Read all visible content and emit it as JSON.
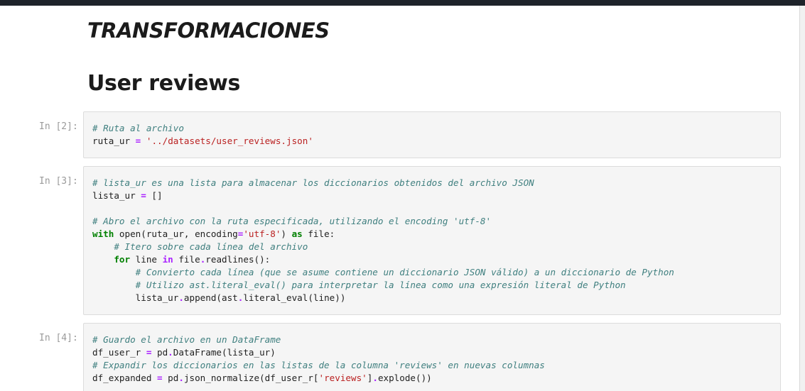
{
  "headings": {
    "section": "TRANSFORMACIONES",
    "subsection": "User reviews"
  },
  "cells": [
    {
      "prompt": "In [2]:",
      "lines": [
        [
          {
            "t": "# Ruta al archivo",
            "c": "c"
          }
        ],
        [
          {
            "t": "ruta_ur "
          },
          {
            "t": "=",
            "c": "o"
          },
          {
            "t": " "
          },
          {
            "t": "'../datasets/user_reviews.json'",
            "c": "s"
          }
        ]
      ]
    },
    {
      "prompt": "In [3]:",
      "lines": [
        [
          {
            "t": "# lista_ur es una lista para almacenar los diccionarios obtenidos del archivo JSON",
            "c": "c"
          }
        ],
        [
          {
            "t": "lista_ur "
          },
          {
            "t": "=",
            "c": "o"
          },
          {
            "t": " []"
          }
        ],
        [],
        [
          {
            "t": "# Abro el archivo con la ruta especificada, utilizando el encoding 'utf-8'",
            "c": "c"
          }
        ],
        [
          {
            "t": "with",
            "c": "k"
          },
          {
            "t": " open(ruta_ur, encoding"
          },
          {
            "t": "=",
            "c": "o"
          },
          {
            "t": "'utf-8'",
            "c": "s"
          },
          {
            "t": ") "
          },
          {
            "t": "as",
            "c": "k"
          },
          {
            "t": " file:"
          }
        ],
        [
          {
            "t": "    "
          },
          {
            "t": "# Itero sobre cada línea del archivo",
            "c": "c"
          }
        ],
        [
          {
            "t": "    "
          },
          {
            "t": "for",
            "c": "k"
          },
          {
            "t": " line "
          },
          {
            "t": "in",
            "c": "ow"
          },
          {
            "t": " file"
          },
          {
            "t": ".",
            "c": "o"
          },
          {
            "t": "readlines():"
          }
        ],
        [
          {
            "t": "        "
          },
          {
            "t": "# Convierto cada línea (que se asume contiene un diccionario JSON válido) a un diccionario de Python",
            "c": "c"
          }
        ],
        [
          {
            "t": "        "
          },
          {
            "t": "# Utilizo ast.literal_eval() para interpretar la línea como una expresión literal de Python",
            "c": "c"
          }
        ],
        [
          {
            "t": "        lista_ur"
          },
          {
            "t": ".",
            "c": "o"
          },
          {
            "t": "append(ast"
          },
          {
            "t": ".",
            "c": "o"
          },
          {
            "t": "literal_eval(line))"
          }
        ]
      ]
    },
    {
      "prompt": "In [4]:",
      "lines": [
        [
          {
            "t": "# Guardo el archivo en un DataFrame",
            "c": "c"
          }
        ],
        [
          {
            "t": "df_user_r "
          },
          {
            "t": "=",
            "c": "o"
          },
          {
            "t": " pd"
          },
          {
            "t": ".",
            "c": "o"
          },
          {
            "t": "DataFrame(lista_ur)"
          }
        ],
        [
          {
            "t": "# Expandir los diccionarios en las listas de la columna 'reviews' en nuevas columnas",
            "c": "c"
          }
        ],
        [
          {
            "t": "df_expanded "
          },
          {
            "t": "=",
            "c": "o"
          },
          {
            "t": " pd"
          },
          {
            "t": ".",
            "c": "o"
          },
          {
            "t": "json_normalize(df_user_r["
          },
          {
            "t": "'reviews'",
            "c": "s"
          },
          {
            "t": "]"
          },
          {
            "t": ".",
            "c": "o"
          },
          {
            "t": "explode())"
          }
        ]
      ]
    }
  ]
}
